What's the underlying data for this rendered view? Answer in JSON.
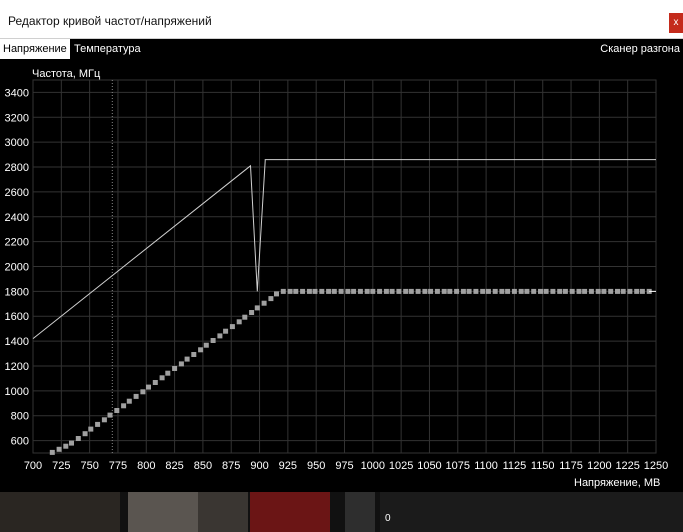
{
  "window": {
    "title": "Редактор кривой частот/напряжений",
    "close_label": "x"
  },
  "tabs": [
    {
      "label": "Напряжение"
    },
    {
      "label": "Температура"
    }
  ],
  "scanner_label": "Сканер разгона",
  "colors": {
    "grid": "#333333",
    "curve": "#d0d0d0",
    "points": "#a0a0a0",
    "accent": "#c42b1c"
  },
  "background": {
    "status_value": "0"
  },
  "chart_data": {
    "type": "line",
    "ylabel": "Частота, МГц",
    "xlabel": "Напряжение, МВ",
    "xlim": [
      700,
      1250
    ],
    "ylim": [
      500,
      3500
    ],
    "x_ticks": [
      700,
      725,
      750,
      775,
      800,
      825,
      850,
      875,
      900,
      925,
      950,
      975,
      1000,
      1025,
      1050,
      1075,
      1100,
      1125,
      1150,
      1175,
      1200,
      1225,
      1250
    ],
    "y_ticks": [
      600,
      800,
      1000,
      1200,
      1400,
      1600,
      1800,
      2000,
      2200,
      2400,
      2600,
      2800,
      3000,
      3200,
      3400
    ],
    "grid": true,
    "marker_x": 770,
    "series": [
      {
        "style": "line",
        "x": [
          700,
          892,
          898,
          905,
          905,
          1250
        ],
        "y": [
          1420,
          2810,
          1800,
          2850,
          2860,
          2860
        ]
      },
      {
        "style": "markers",
        "x": [
          717,
          723,
          729,
          734,
          740,
          746,
          751,
          757,
          763,
          768,
          774,
          780,
          785,
          791,
          797,
          802,
          808,
          814,
          819,
          825,
          831,
          836,
          842,
          848,
          853,
          859,
          865,
          870,
          876,
          882,
          887,
          893,
          898,
          904,
          910,
          915,
          921,
          927,
          932,
          938,
          944,
          949,
          955,
          961,
          966,
          972,
          978,
          983,
          989,
          995,
          1000,
          1006,
          1012,
          1017,
          1023,
          1029,
          1034,
          1040,
          1046,
          1051,
          1057,
          1063,
          1068,
          1074,
          1080,
          1085,
          1091,
          1097,
          1102,
          1108,
          1114,
          1119,
          1125,
          1131,
          1136,
          1142,
          1148,
          1153,
          1159,
          1165,
          1170,
          1176,
          1182,
          1187,
          1193,
          1199,
          1204,
          1210,
          1216,
          1221,
          1227,
          1233,
          1238,
          1244
        ],
        "y": [
          505,
          530,
          555,
          580,
          617,
          655,
          692,
          730,
          767,
          805,
          842,
          880,
          917,
          955,
          992,
          1030,
          1067,
          1105,
          1142,
          1180,
          1217,
          1255,
          1292,
          1330,
          1367,
          1405,
          1442,
          1480,
          1517,
          1555,
          1592,
          1630,
          1667,
          1705,
          1742,
          1780,
          1800,
          1800,
          1800,
          1800,
          1800,
          1800,
          1800,
          1800,
          1800,
          1800,
          1800,
          1800,
          1800,
          1800,
          1800,
          1800,
          1800,
          1800,
          1800,
          1800,
          1800,
          1800,
          1800,
          1800,
          1800,
          1800,
          1800,
          1800,
          1800,
          1800,
          1800,
          1800,
          1800,
          1800,
          1800,
          1800,
          1800,
          1800,
          1800,
          1800,
          1800,
          1800,
          1800,
          1800,
          1800,
          1800,
          1800,
          1800,
          1800,
          1800,
          1800,
          1800,
          1800,
          1800,
          1800,
          1800,
          1800,
          1800
        ]
      }
    ]
  }
}
